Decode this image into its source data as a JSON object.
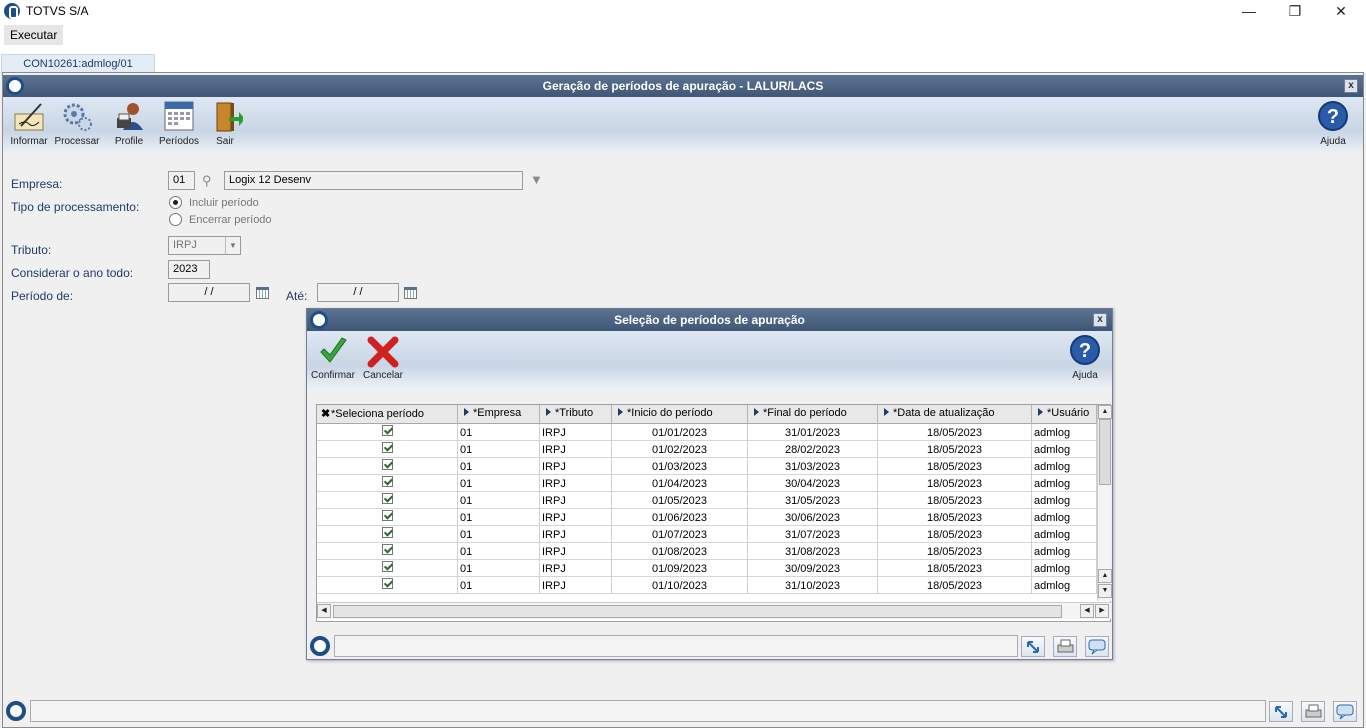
{
  "os": {
    "title": "TOTVS S/A",
    "minimize": "—",
    "restore": "❐",
    "close": "✕"
  },
  "menu": {
    "executar": "Executar"
  },
  "tab": {
    "label": "CON10261:admlog/01"
  },
  "main": {
    "title": "Geração de períodos de apuração - LALUR/LACS",
    "close": "x",
    "toolbar": [
      {
        "label": "Informar",
        "icon": "pen-paper-icon"
      },
      {
        "label": "Processar",
        "icon": "gears-icon"
      },
      {
        "label": "Profile",
        "icon": "user-profile-icon"
      },
      {
        "label": "Períodos",
        "icon": "calendar-icon"
      },
      {
        "label": "Sair",
        "icon": "exit-door-icon"
      }
    ],
    "help_label": "Ajuda",
    "form": {
      "empresa_label": "Empresa:",
      "empresa_code": "01",
      "empresa_name": "Logix 12 Desenv",
      "tipo_label": "Tipo de processamento:",
      "radio_incluir": "Incluir período",
      "radio_encerrar": "Encerrar período",
      "tributo_label": "Tributo:",
      "tributo_value": "IRPJ",
      "ano_label": "Considerar o ano todo:",
      "ano_value": "2023",
      "periodo_de_label": "Período de:",
      "periodo_de_value": "/ /",
      "ate_label": "Até:",
      "ate_value": "/ /"
    }
  },
  "dialog": {
    "title": "Seleção de períodos de apuração",
    "close": "x",
    "confirm_label": "Confirmar",
    "cancel_label": "Cancelar",
    "help_label": "Ajuda",
    "columns": [
      "*Seleciona período",
      "*Empresa",
      "*Tributo",
      "*Inicio do período",
      "*Final do período",
      "*Data de atualização",
      "*Usuário"
    ],
    "rows": [
      [
        "01",
        "IRPJ",
        "01/01/2023",
        "31/01/2023",
        "18/05/2023",
        "admlog"
      ],
      [
        "01",
        "IRPJ",
        "01/02/2023",
        "28/02/2023",
        "18/05/2023",
        "admlog"
      ],
      [
        "01",
        "IRPJ",
        "01/03/2023",
        "31/03/2023",
        "18/05/2023",
        "admlog"
      ],
      [
        "01",
        "IRPJ",
        "01/04/2023",
        "30/04/2023",
        "18/05/2023",
        "admlog"
      ],
      [
        "01",
        "IRPJ",
        "01/05/2023",
        "31/05/2023",
        "18/05/2023",
        "admlog"
      ],
      [
        "01",
        "IRPJ",
        "01/06/2023",
        "30/06/2023",
        "18/05/2023",
        "admlog"
      ],
      [
        "01",
        "IRPJ",
        "01/07/2023",
        "31/07/2023",
        "18/05/2023",
        "admlog"
      ],
      [
        "01",
        "IRPJ",
        "01/08/2023",
        "31/08/2023",
        "18/05/2023",
        "admlog"
      ],
      [
        "01",
        "IRPJ",
        "01/09/2023",
        "30/09/2023",
        "18/05/2023",
        "admlog"
      ],
      [
        "01",
        "IRPJ",
        "01/10/2023",
        "31/10/2023",
        "18/05/2023",
        "admlog"
      ]
    ]
  }
}
